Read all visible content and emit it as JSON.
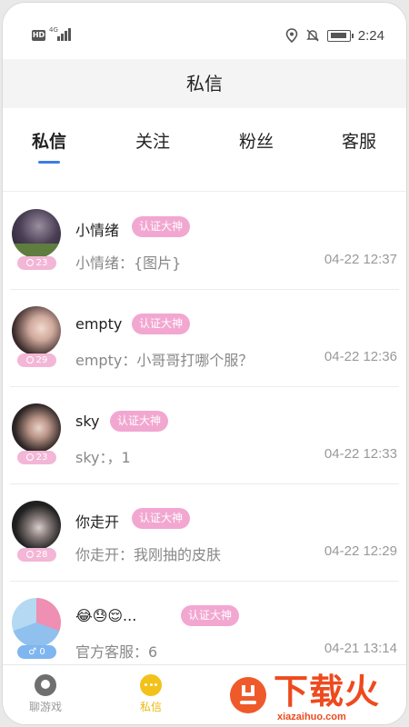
{
  "status_bar": {
    "hd_label": "HD",
    "network_label": "4G",
    "time": "2:24",
    "icons": [
      "location-icon",
      "mute-bell-icon",
      "battery-icon"
    ]
  },
  "header": {
    "title": "私信"
  },
  "tabs": [
    {
      "label": "私信",
      "active": true
    },
    {
      "label": "关注",
      "active": false
    },
    {
      "label": "粉丝",
      "active": false
    },
    {
      "label": "客服",
      "active": false
    }
  ],
  "conversations": [
    {
      "name": "小情绪",
      "tag": "认证大神",
      "preview": "小情绪：{图片}",
      "time": "04-22 12:37",
      "badge": "23"
    },
    {
      "name": "empty",
      "tag": "认证大神",
      "preview": "empty：小哥哥打哪个服？",
      "time": "04-22 12:36",
      "badge": "29"
    },
    {
      "name": "sky",
      "tag": "认证大神",
      "preview": "sky：，1",
      "time": "04-22 12:33",
      "badge": "23"
    },
    {
      "name": "你走开",
      "tag": "认证大神",
      "preview": "你走开：我刚抽的皮肤",
      "time": "04-22 12:29",
      "badge": "28"
    },
    {
      "name": "😂😓😌...",
      "tag": "认证大神",
      "preview": "官方客服：6",
      "time": "04-21 13:14",
      "badge": "0"
    }
  ],
  "bottom_nav": [
    {
      "label": "聊游戏",
      "icon": "chat-game-icon",
      "active": false
    },
    {
      "label": "私信",
      "icon": "message-icon",
      "active": true
    }
  ],
  "watermark": {
    "text": "下载火",
    "url": "xiazaihuo.com"
  },
  "colors": {
    "accent": "#3d7de4",
    "tag_pink": "#f2a7d1",
    "nav_active": "#e8b80c",
    "watermark": "#ee4a1e"
  }
}
